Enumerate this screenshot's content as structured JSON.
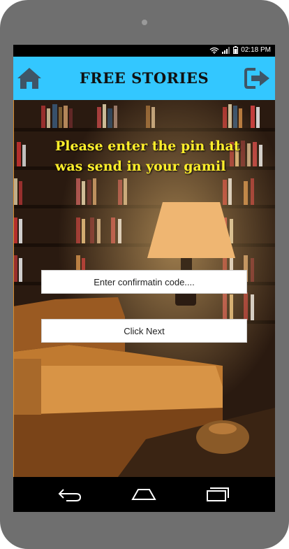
{
  "status_bar": {
    "time": "02:18 PM",
    "icons": [
      "wifi-icon",
      "signal-icon",
      "battery-icon"
    ]
  },
  "app_bar": {
    "title": "FREE STORIES",
    "left_icon": "home-icon",
    "right_icon": "logout-icon",
    "background_color": "#33c7ff"
  },
  "main": {
    "prompt": "Please enter the pin that was send in your gamil",
    "prompt_color": "#ffef2b",
    "code_input": {
      "placeholder": "Enter confirmatin code....",
      "value": ""
    },
    "next_button_label": "Click Next"
  },
  "nav_bar": {
    "icons": [
      "back-icon",
      "home-nav-icon",
      "recent-apps-icon"
    ]
  }
}
